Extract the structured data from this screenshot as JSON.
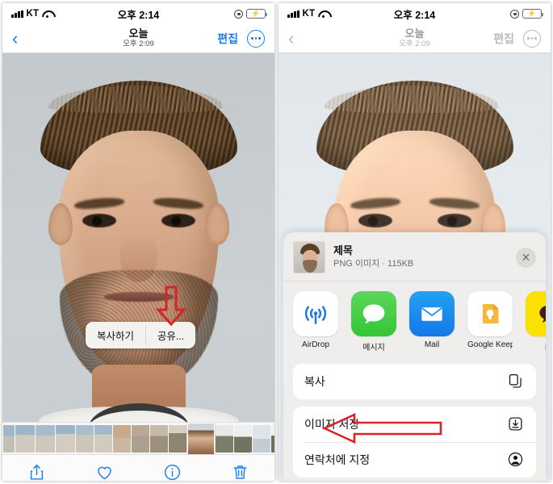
{
  "left_phone": {
    "status_bar": {
      "carrier": "KT",
      "time": "오후 2:14",
      "signal_icon": "cellular-signal-icon",
      "wifi_icon": "wifi-icon",
      "rotation_lock_icon": "rotation-lock-icon",
      "battery_icon": "battery-charging-icon"
    },
    "nav": {
      "back_icon": "chevron-left-icon",
      "title": "오늘",
      "subtitle": "오후 2:09",
      "edit_label": "편집",
      "more_icon": "ellipsis-circle-icon"
    },
    "context_menu": {
      "copy_label": "복사하기",
      "share_label": "공유..."
    },
    "annotation": {
      "arrow_color": "#d8232a",
      "arrow_direction": "down",
      "points_at": "공유..."
    },
    "toolbar": {
      "share_icon": "share-up-icon",
      "favorite_icon": "heart-icon",
      "info_icon": "info-circle-icon",
      "delete_icon": "trash-icon"
    }
  },
  "right_phone": {
    "status_bar": {
      "carrier": "KT",
      "time": "오후 2:14",
      "signal_icon": "cellular-signal-icon",
      "wifi_icon": "wifi-icon",
      "rotation_lock_icon": "rotation-lock-icon",
      "battery_icon": "battery-charging-icon"
    },
    "nav": {
      "back_icon": "chevron-left-icon",
      "title": "오늘",
      "subtitle": "오후 2:09",
      "edit_label": "편집",
      "more_icon": "ellipsis-circle-icon"
    },
    "share_sheet": {
      "item_title": "제목",
      "item_subtitle": "PNG 이미지 · 115KB",
      "close_icon": "close-x-icon",
      "apps": [
        {
          "label": "AirDrop",
          "icon": "airdrop-icon"
        },
        {
          "label": "메시지",
          "icon": "messages-icon"
        },
        {
          "label": "Mail",
          "icon": "mail-icon"
        },
        {
          "label": "Google Keep",
          "icon": "google-keep-icon"
        },
        {
          "label": "카",
          "icon": "kakaotalk-icon"
        }
      ],
      "actions": [
        {
          "label": "복사",
          "icon": "copy-icon"
        },
        {
          "label": "이미지 저장",
          "icon": "save-download-icon"
        },
        {
          "label": "연락처에 지정",
          "icon": "contact-person-icon"
        }
      ]
    },
    "annotation": {
      "arrow_color": "#d8232a",
      "arrow_direction": "left",
      "points_at": "이미지 저장"
    }
  }
}
